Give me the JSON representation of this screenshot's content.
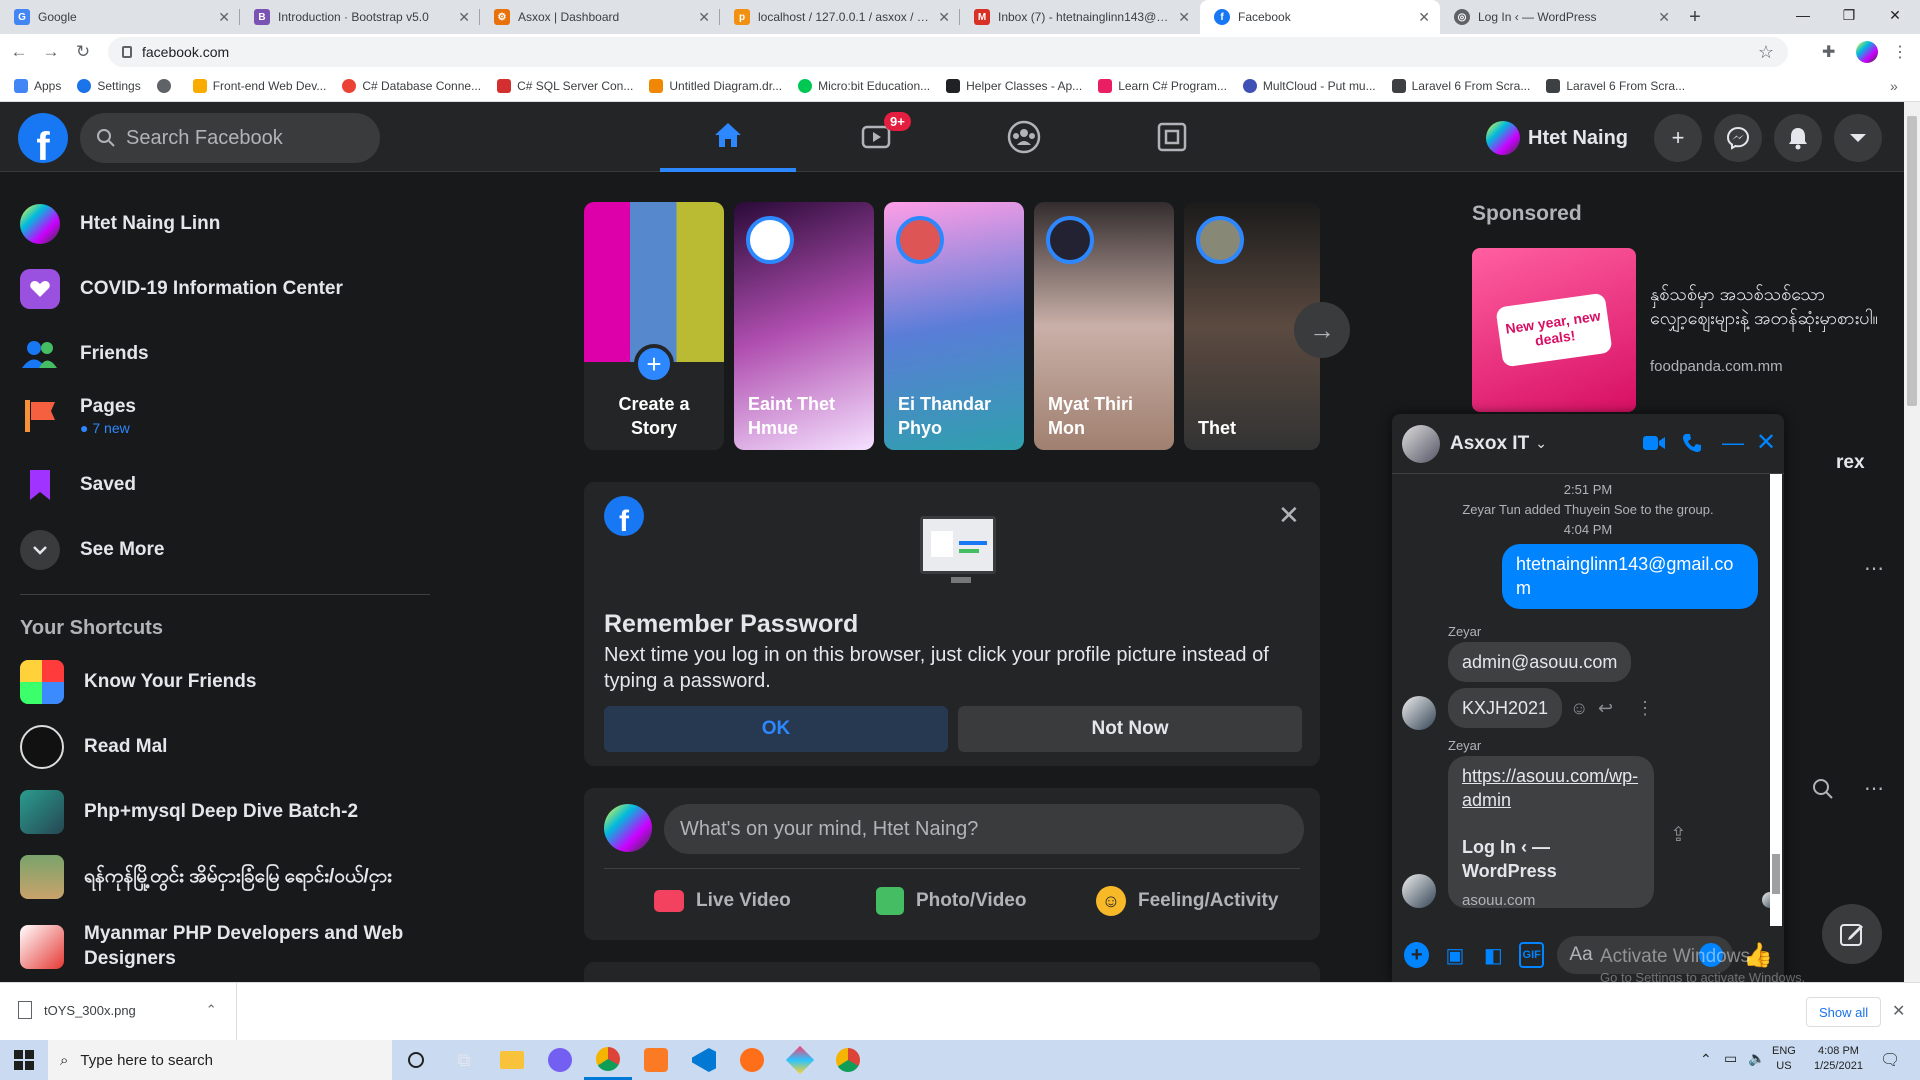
{
  "browser": {
    "tabs": [
      {
        "title": "Google",
        "favicon": "G",
        "color": "#4285f4"
      },
      {
        "title": "Introduction · Bootstrap v5.0",
        "favicon": "B",
        "color": "#7952b3"
      },
      {
        "title": "Asxox | Dashboard",
        "favicon": "⚙",
        "color": "#e8710a"
      },
      {
        "title": "localhost / 127.0.0.1 / asxox / orc",
        "favicon": "p",
        "color": "#f29111"
      },
      {
        "title": "Inbox (7) - htetnainglinn143@gm",
        "favicon": "M",
        "color": "#d93025"
      },
      {
        "title": "Facebook",
        "favicon": "f",
        "color": "#1877f2"
      },
      {
        "title": "Log In ‹ — WordPress",
        "favicon": "◎",
        "color": "#5f6368"
      }
    ],
    "url": "facebook.com",
    "bookmarks": [
      {
        "label": "Apps",
        "color": "#4285f4"
      },
      {
        "label": "Settings",
        "color": "#1a73e8"
      },
      {
        "label": "",
        "color": "#5f6368"
      },
      {
        "label": "Front-end Web Dev...",
        "color": "#f9ab00"
      },
      {
        "label": "C# Database Conne...",
        "color": "#ea4335"
      },
      {
        "label": "C# SQL Server Con...",
        "color": "#d32f2f"
      },
      {
        "label": "Untitled Diagram.dr...",
        "color": "#f08705"
      },
      {
        "label": "Micro:bit Education...",
        "color": "#00c853"
      },
      {
        "label": "Helper Classes - Ap...",
        "color": "#202124"
      },
      {
        "label": "Learn C# Program...",
        "color": "#e91e63"
      },
      {
        "label": "MultCloud - Put mu...",
        "color": "#3f51b5"
      },
      {
        "label": "Laravel 6 From Scra...",
        "color": "#3c4043"
      },
      {
        "label": "Laravel 6 From Scra...",
        "color": "#3c4043"
      }
    ]
  },
  "header": {
    "search_placeholder": "Search Facebook",
    "watch_badge": "9+",
    "profile_name": "Htet Naing"
  },
  "sidebar": {
    "profile": "Htet Naing Linn",
    "items": [
      {
        "label": "COVID-19 Information Center",
        "sub": ""
      },
      {
        "label": "Friends",
        "sub": ""
      },
      {
        "label": "Pages",
        "sub": "7 new"
      },
      {
        "label": "Saved",
        "sub": ""
      },
      {
        "label": "See More",
        "sub": ""
      }
    ],
    "shortcuts_title": "Your Shortcuts",
    "shortcuts": [
      "Know Your Friends",
      "Read Mal",
      "Php+mysql Deep Dive Batch-2",
      "ရန်ကုန်မြို့တွင်း အိမ်ငှားခြံမြေ ရောင်း/ဝယ်/ငှား",
      "Myanmar PHP Developers and Web Designers"
    ]
  },
  "stories": [
    "Create a Story",
    "Eaint Thet Hmue",
    "Ei Thandar Phyo",
    "Myat Thiri Mon",
    "Thet"
  ],
  "remember_password": {
    "title": "Remember Password",
    "text": "Next time you log in on this browser, just click your profile picture instead of typing a password.",
    "ok": "OK",
    "not_now": "Not Now"
  },
  "composer": {
    "placeholder": "What's on your mind, Htet Naing?",
    "live": "Live Video",
    "photo": "Photo/Video",
    "feeling": "Feeling/Activity"
  },
  "right_rail": {
    "sponsored": "Sponsored",
    "ad_text": "နှစ်သစ်မှာ အသစ်သစ်သော လျှော့ဈေးများနဲ့ အတန်ဆုံးမှာစားပါ။",
    "ad_domain": "foodpanda.com.mm",
    "ad_image_text": "New year, new deals!",
    "partial_text": "rex"
  },
  "chat": {
    "title": "Asxox IT",
    "messages": {
      "time1": "2:51 PM",
      "system": "Zeyar Tun added Thuyein Soe to the group.",
      "time2": "4:04 PM",
      "mine": "htetnainglinn143@gmail.com",
      "sender1": "Zeyar",
      "m1": "admin@asouu.com",
      "m2": "KXJH2021",
      "sender2": "Zeyar",
      "link": "https://asouu.com/wp-admin",
      "link_title": "Log In ‹ — WordPress",
      "link_domain": "asouu.com"
    },
    "input_placeholder": "Aa"
  },
  "watermark": {
    "line1": "Activate Windows",
    "line2": "Go to Settings to activate Windows."
  },
  "download": {
    "file": "tOYS_300x.png",
    "show_all": "Show all"
  },
  "taskbar": {
    "search_placeholder": "Type here to search",
    "lang1": "ENG",
    "lang2": "US",
    "time": "4:08 PM",
    "date": "1/25/2021"
  }
}
